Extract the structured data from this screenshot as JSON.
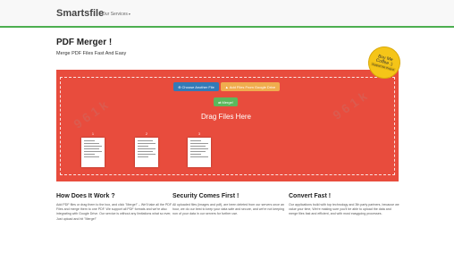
{
  "navbar": {
    "brand": "Smartsfile",
    "services_label": "Our Services",
    "accent": "#4caf50"
  },
  "hero": {
    "title": "PDF Merger !",
    "subtitle": "Merge PDF Files Fast And Easy"
  },
  "coffee_badge": {
    "line1": "Buy Me",
    "line2": "Coffee :)",
    "line3": "Support the Project"
  },
  "dropzone": {
    "color": "#e84c3d",
    "choose_button": "Choose Another File",
    "gdrive_button": "Add Files From Google Drive",
    "merge_button": "Merge!",
    "drag_text": "Drag Files Here",
    "files": [
      {
        "num": "1"
      },
      {
        "num": "2"
      },
      {
        "num": "3"
      }
    ]
  },
  "info": [
    {
      "title": "How Does It Work ?",
      "body": "Add PDF files or drag them to the box, and click \"Merge!\" – We'll take all the PDF Files and merge them to one PDF. We support all PDF formats and we're also integrating with Google Drive. Our service is without any limitations what so ever, Just upload and hit \"Merge!\""
    },
    {
      "title": "Security Comes First !",
      "body": "All uploaded files (images and pdf), are been deleted from our servers once an hour, we do our best to keep your data safe and secure, and we're not keeping non of your data in our servers for further use."
    },
    {
      "title": "Convert Fast !",
      "body": "Our applications build with top technology and 3th party partners, because we value your time, We're making sure you'll be able to upload the data and merge files fast and efficient, and with most easygoing processes."
    }
  ],
  "watermark": "9 6 1 k"
}
